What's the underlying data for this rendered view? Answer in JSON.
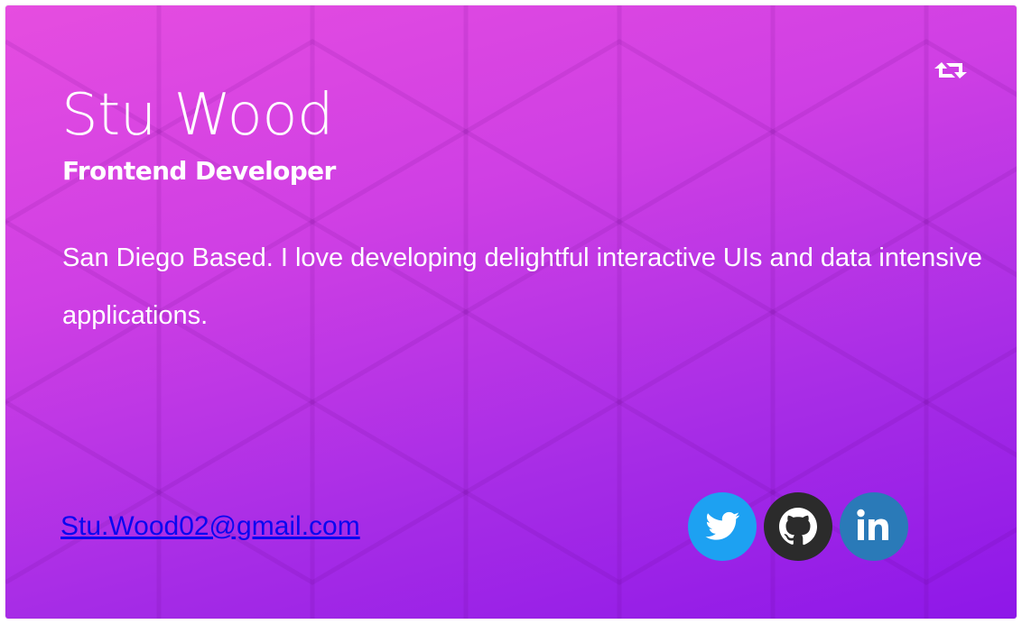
{
  "profile": {
    "name": "Stu Wood",
    "role": "Frontend Developer",
    "bio": "San Diego Based. I love developing delightful interactive UIs and data intensive applications.",
    "email": "Stu.Wood02@gmail.com"
  },
  "icons": {
    "flip": "retweet-icon",
    "twitter": "twitter-icon",
    "github": "github-icon",
    "linkedin": "linkedin-icon"
  },
  "colors": {
    "gradient_top": "#e64de0",
    "gradient_bottom": "#8e17e8",
    "text": "#ffffff",
    "email_link": "#0a08f0",
    "twitter": "#1da1f2",
    "github": "#2b2b2b",
    "linkedin": "#2a7ab8"
  }
}
